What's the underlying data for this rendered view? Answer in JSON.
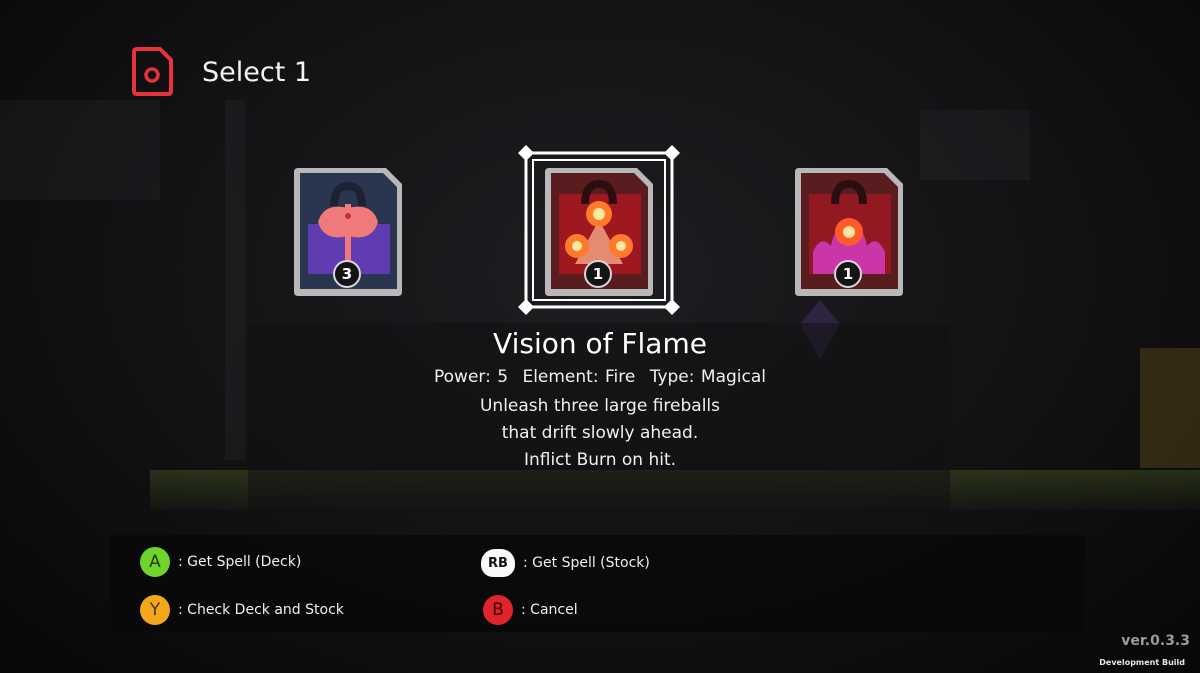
{
  "header": {
    "title": "Select 1",
    "icon": "card-icon",
    "accent_color": "#e8323c"
  },
  "cards": [
    {
      "name": "axe-spell-card",
      "icon": "axe-icon",
      "count": "3",
      "selected": false,
      "frame_color": "#2b3850"
    },
    {
      "name": "vision-of-flame-card",
      "icon": "triple-fireball-icon",
      "count": "1",
      "selected": true,
      "frame_color": "#5a1d1f"
    },
    {
      "name": "fire-burst-card",
      "icon": "flame-burst-icon",
      "count": "1",
      "selected": false,
      "frame_color": "#5a1d1f"
    }
  ],
  "spell": {
    "name": "Vision of Flame",
    "power_label": "Power: 5",
    "element_label": "Element: Fire",
    "type_label": "Type: Magical",
    "description": [
      "Unleash three large fireballs",
      "that drift slowly ahead.",
      "Inflict Burn on hit."
    ]
  },
  "controls": [
    {
      "button": "A",
      "label": ": Get Spell (Deck)",
      "color": "#6fd42c"
    },
    {
      "button": "RB",
      "label": ": Get Spell (Stock)",
      "color": "#fafafa"
    },
    {
      "button": "Y",
      "label": ": Check Deck and Stock",
      "color": "#f3a81c"
    },
    {
      "button": "B",
      "label": ": Cancel",
      "color": "#e0242c"
    }
  ],
  "footer": {
    "version": "ver.0.3.3",
    "build": "Development Build"
  }
}
